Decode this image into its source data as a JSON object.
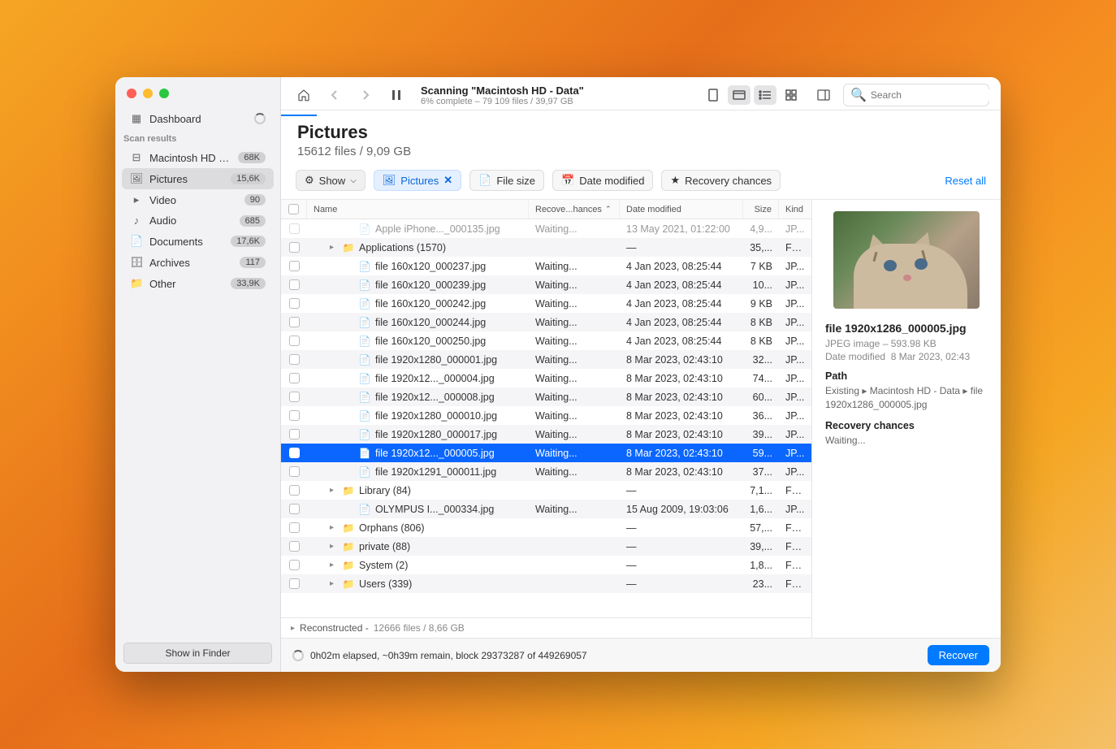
{
  "toolbar": {
    "title": "Scanning \"Macintosh HD - Data\"",
    "subtitle": "6% complete – 79 109 files / 39,97 GB",
    "search_placeholder": "Search"
  },
  "header": {
    "title": "Pictures",
    "subtitle": "15612 files / 9,09 GB"
  },
  "sidebar": {
    "dashboard": "Dashboard",
    "section": "Scan results",
    "items": [
      {
        "icon": "disk",
        "label": "Macintosh HD - Da...",
        "badge": "68K"
      },
      {
        "icon": "image",
        "label": "Pictures",
        "badge": "15,6K",
        "active": true
      },
      {
        "icon": "video",
        "label": "Video",
        "badge": "90"
      },
      {
        "icon": "audio",
        "label": "Audio",
        "badge": "685"
      },
      {
        "icon": "doc",
        "label": "Documents",
        "badge": "17,6K"
      },
      {
        "icon": "archive",
        "label": "Archives",
        "badge": "117"
      },
      {
        "icon": "other",
        "label": "Other",
        "badge": "33,9K"
      }
    ],
    "show_finder": "Show in Finder"
  },
  "filters": {
    "show": "Show",
    "pictures": "Pictures",
    "file_size": "File size",
    "date_modified": "Date modified",
    "recovery": "Recovery chances",
    "reset": "Reset all"
  },
  "columns": {
    "name": "Name",
    "recovery": "Recove...hances",
    "date": "Date modified",
    "size": "Size",
    "kind": "Kind"
  },
  "rows": [
    {
      "indent": 2,
      "type": "file",
      "name": "Apple iPhone..._000135.jpg",
      "rec": "Waiting...",
      "date": "13 May 2021, 01:22:00",
      "size": "4,9...",
      "kind": "JP...",
      "partial": true
    },
    {
      "indent": 1,
      "type": "folder",
      "name": "Applications (1570)",
      "rec": "",
      "date": "—",
      "size": "35,...",
      "kind": "Fol...",
      "caret": true
    },
    {
      "indent": 2,
      "type": "file",
      "name": "file 160x120_000237.jpg",
      "rec": "Waiting...",
      "date": "4 Jan 2023, 08:25:44",
      "size": "7 KB",
      "kind": "JP..."
    },
    {
      "indent": 2,
      "type": "file",
      "name": "file 160x120_000239.jpg",
      "rec": "Waiting...",
      "date": "4 Jan 2023, 08:25:44",
      "size": "10...",
      "kind": "JP..."
    },
    {
      "indent": 2,
      "type": "file",
      "name": "file 160x120_000242.jpg",
      "rec": "Waiting...",
      "date": "4 Jan 2023, 08:25:44",
      "size": "9 KB",
      "kind": "JP..."
    },
    {
      "indent": 2,
      "type": "file",
      "name": "file 160x120_000244.jpg",
      "rec": "Waiting...",
      "date": "4 Jan 2023, 08:25:44",
      "size": "8 KB",
      "kind": "JP..."
    },
    {
      "indent": 2,
      "type": "file",
      "name": "file 160x120_000250.jpg",
      "rec": "Waiting...",
      "date": "4 Jan 2023, 08:25:44",
      "size": "8 KB",
      "kind": "JP..."
    },
    {
      "indent": 2,
      "type": "file",
      "name": "file 1920x1280_000001.jpg",
      "rec": "Waiting...",
      "date": "8 Mar 2023, 02:43:10",
      "size": "32...",
      "kind": "JP..."
    },
    {
      "indent": 2,
      "type": "file",
      "name": "file 1920x12..._000004.jpg",
      "rec": "Waiting...",
      "date": "8 Mar 2023, 02:43:10",
      "size": "74...",
      "kind": "JP..."
    },
    {
      "indent": 2,
      "type": "file",
      "name": "file 1920x12..._000008.jpg",
      "rec": "Waiting...",
      "date": "8 Mar 2023, 02:43:10",
      "size": "60...",
      "kind": "JP..."
    },
    {
      "indent": 2,
      "type": "file",
      "name": "file 1920x1280_000010.jpg",
      "rec": "Waiting...",
      "date": "8 Mar 2023, 02:43:10",
      "size": "36...",
      "kind": "JP..."
    },
    {
      "indent": 2,
      "type": "file",
      "name": "file 1920x1280_000017.jpg",
      "rec": "Waiting...",
      "date": "8 Mar 2023, 02:43:10",
      "size": "39...",
      "kind": "JP..."
    },
    {
      "indent": 2,
      "type": "file",
      "name": "file 1920x12..._000005.jpg",
      "rec": "Waiting...",
      "date": "8 Mar 2023, 02:43:10",
      "size": "59...",
      "kind": "JP...",
      "selected": true
    },
    {
      "indent": 2,
      "type": "file",
      "name": "file 1920x1291_000011.jpg",
      "rec": "Waiting...",
      "date": "8 Mar 2023, 02:43:10",
      "size": "37...",
      "kind": "JP..."
    },
    {
      "indent": 1,
      "type": "folder",
      "name": "Library (84)",
      "rec": "",
      "date": "—",
      "size": "7,1...",
      "kind": "Fol...",
      "caret": true
    },
    {
      "indent": 2,
      "type": "file",
      "name": "OLYMPUS I..._000334.jpg",
      "rec": "Waiting...",
      "date": "15 Aug 2009, 19:03:06",
      "size": "1,6...",
      "kind": "JP..."
    },
    {
      "indent": 1,
      "type": "folder",
      "name": "Orphans (806)",
      "rec": "",
      "date": "—",
      "size": "57,...",
      "kind": "Fol...",
      "caret": true
    },
    {
      "indent": 1,
      "type": "folder",
      "name": "private (88)",
      "rec": "",
      "date": "—",
      "size": "39,...",
      "kind": "Fol...",
      "caret": true
    },
    {
      "indent": 1,
      "type": "folder",
      "name": "System (2)",
      "rec": "",
      "date": "—",
      "size": "1,8...",
      "kind": "Fol...",
      "caret": true
    },
    {
      "indent": 1,
      "type": "folder",
      "name": "Users (339)",
      "rec": "",
      "date": "—",
      "size": "23...",
      "kind": "Fol...",
      "caret": true
    }
  ],
  "reconstructed": {
    "label": "Reconstructed -",
    "value": "12666 files / 8,66 GB"
  },
  "status": "0h02m elapsed, ~0h39m remain, block 29373287 of 449269057",
  "recover_btn": "Recover",
  "detail": {
    "filename": "file 1920x1286_000005.jpg",
    "meta1": "JPEG image – 593.98 KB",
    "meta2_label": "Date modified",
    "meta2_value": "8 Mar 2023, 02:43",
    "path_label": "Path",
    "path_value": "Existing ▸ Macintosh HD - Data ▸ file 1920x1286_000005.jpg",
    "recovery_label": "Recovery chances",
    "recovery_value": "Waiting..."
  }
}
